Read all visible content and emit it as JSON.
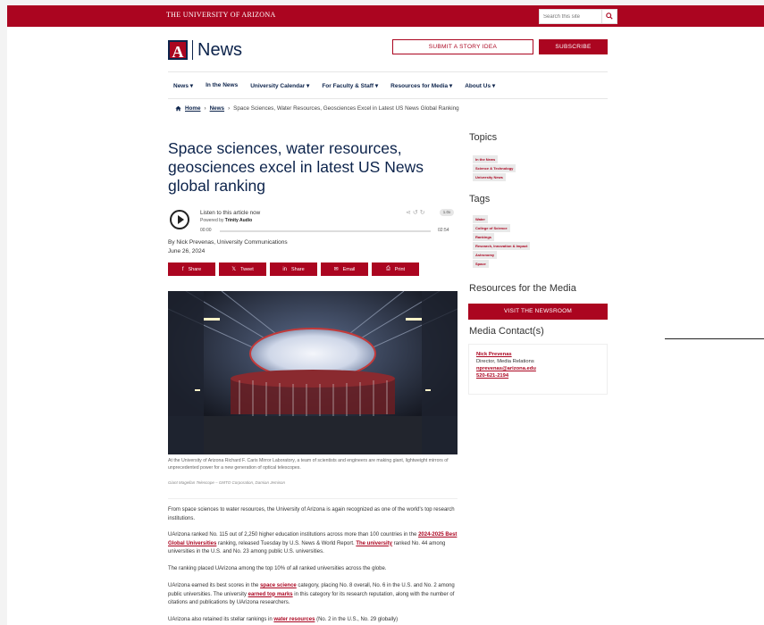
{
  "topbar": {
    "brand": "The University of Arizona",
    "search_placeholder": "Search this site"
  },
  "header": {
    "logo_letter": "A",
    "logo_word": "News",
    "submit_label": "SUBMIT A STORY IDEA",
    "subscribe_label": "SUBSCRIBE"
  },
  "nav": {
    "items": [
      "News ▾",
      "In the News",
      "University Calendar ▾",
      "For Faculty & Staff ▾",
      "Resources for Media ▾",
      "About Us ▾"
    ]
  },
  "breadcrumb": {
    "home": "Home",
    "news": "News",
    "sep": "›",
    "current": "Space Sciences, Water Resources, Geosciences Excel in Latest US News Global Ranking"
  },
  "article": {
    "title": "Space sciences, water resources, geosciences excel in latest US News global ranking",
    "audio": {
      "label": "Listen to this article now",
      "powered_prefix": "Powered by",
      "powered_by": "Trinity Audio",
      "time_start": "00:00",
      "time_end": "02:54",
      "speed": "1.0x"
    },
    "byline": "By Nick Prevenas, University Communications",
    "date": "June 26, 2024",
    "shares": [
      {
        "icon": "f",
        "label": "Share"
      },
      {
        "icon": "𝕏",
        "label": "Tweet"
      },
      {
        "icon": "in",
        "label": "Share"
      },
      {
        "icon": "✉",
        "label": "Email"
      },
      {
        "icon": "⎙",
        "label": "Print"
      }
    ],
    "caption": "At the University of Arizona Richard F. Caris Mirror Laboratory, a team of scientists and engineers are making giant, lightweight mirrors of unprecedented power for a new generation of optical telescopes.",
    "credit": "Giant Magellan Telescope – GMTO Corporation, Damian Jemison",
    "p1": "From space sciences to water resources, the University of Arizona is again recognized as one of the world's top research institutions.",
    "p2_a": "UArizona ranked No. 115 out of 2,250 higher education institutions across more than 100 countries in the ",
    "p2_link1": "2024-2025 Best Global Universities",
    "p2_b": " ranking, released Tuesday by U.S. News & World Report. ",
    "p2_link2": "The university",
    "p2_c": " ranked No. 44 among universities in the U.S. and No. 23 among public U.S. universities.",
    "p3": "The ranking placed UArizona among the top 10% of all ranked universities across the globe.",
    "p4_a": "UArizona earned its best scores in the ",
    "p4_link1": "space science",
    "p4_b": " category, placing No. 8 overall, No. 6 in the U.S. and No. 2 among public universities. The university ",
    "p4_link2": "earned top marks",
    "p4_c": " in this category for its research reputation, along with the number of citations and publications by UArizona researchers.",
    "p5_a": "UArizona also retained its stellar rankings in ",
    "p5_link": "water resources",
    "p5_b": " (No. 2 in the U.S., No. 29 globally)"
  },
  "sidebar": {
    "topics_heading": "Topics",
    "topics": [
      "In the News",
      "Science & Technology",
      "University News"
    ],
    "tags_heading": "Tags",
    "tags": [
      "Water",
      "College of Science",
      "Rankings",
      "Research, Innovation & Impact",
      "Astronomy",
      "Space"
    ],
    "resources_heading": "Resources for the Media",
    "newsroom_label": "VISIT THE NEWSROOM",
    "contact_heading": "Media Contact(s)",
    "contact": {
      "name": "Nick Prevenas",
      "role": "Director, Media Relations",
      "email": "nprevenas@arizona.edu",
      "phone": "520-621-2194"
    }
  },
  "colors": {
    "brand_red": "#ab0520",
    "brand_navy": "#0c234b"
  }
}
